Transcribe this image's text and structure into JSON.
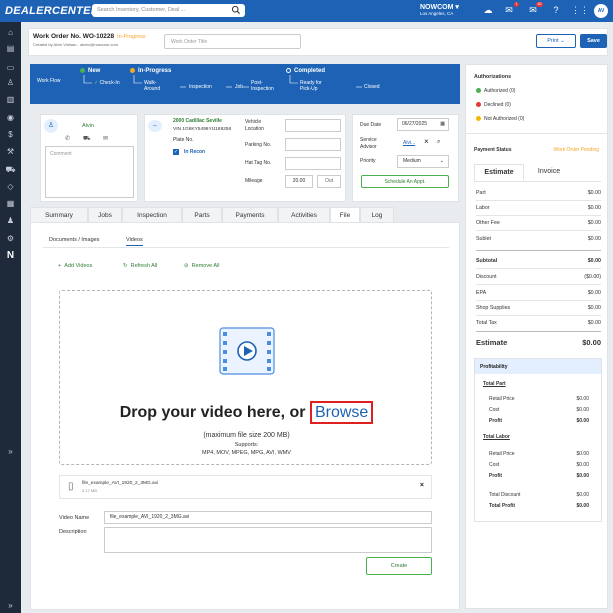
{
  "topbar": {
    "brand": "DEALERCENTER",
    "search_placeholder": "Search Inventory, Customer, Deal ...",
    "dealer_name": "NOWCOM",
    "dealer_location": "Los Angeles, CA",
    "notification_count_1": "1",
    "notification_count_2": "40",
    "avatar_initials": "AV"
  },
  "header": {
    "work_order_label": "Work Order No. WO-10228",
    "status": "In-Progress",
    "created_by": "Created by Alvin Vinluan - alvinv@nowcom.com",
    "title_placeholder": "Work Order Title",
    "print_label": "Print",
    "save_label": "Save"
  },
  "workflow": {
    "label": "Work Flow",
    "stages": {
      "new": "New",
      "in_progress": "In-Progress",
      "completed": "Completed"
    },
    "steps": {
      "check_in": "Check-In",
      "walk_around": "Walk-\nAround",
      "inspection": "Inspection",
      "job": "Job",
      "post_inspection": "Post-\nInspection",
      "ready_pickup": "Ready for\nPick-Up",
      "closed": "Closed"
    }
  },
  "customer": {
    "name": "Alvin",
    "comment_placeholder": "Comment"
  },
  "vehicle": {
    "model": "2000 Cadillac Seville",
    "vin": "VIN 1G6KY5496YU169258",
    "plate_label": "Plate No.",
    "in_recon": "In Recon",
    "location_label": "Vehicle\nLocation",
    "parking_label": "Parking No.",
    "hat_tag_label": "Hat Tag No.",
    "mileage_label": "Mileage",
    "mileage_value": "20.00",
    "mileage_out": "Out"
  },
  "service": {
    "due_date_label": "Due Date",
    "due_date": "06/27/2025",
    "advisor_label": "Service\nAdvisor",
    "advisor_value": "Alvi...",
    "priority_label": "Priority",
    "priority_value": "Medium",
    "schedule_label": "Schedule An Appt."
  },
  "tabs": [
    "Summary",
    "Jobs",
    "Inspection",
    "Parts",
    "Payments",
    "Activities",
    "File",
    "Log"
  ],
  "file_panel": {
    "subtabs": [
      "Documents / Images",
      "Videos"
    ],
    "add_videos": "Add Videos",
    "refresh_all": "Refresh All",
    "remove_all": "Remove All",
    "drop_text": "Drop your video here, or",
    "browse": "Browse",
    "max_size": "(maximum file size 200 MB)",
    "supports_label": "Supports:",
    "supports_formats": "MP4, MOV, MPEG, MPG, AVI, WMV",
    "file_name": "file_example_AVI_1920_2_3MG.avi",
    "file_size": "2.17 MB",
    "video_name_label": "Video Name",
    "video_name_value": "file_example_AVI_1920_2_3MG.avi",
    "description_label": "Description",
    "create_label": "Create"
  },
  "right_panel": {
    "authorizations_title": "Authorizations",
    "authorized": "Authorized (0)",
    "declined": "Declined (0)",
    "not_authorized": "Not Authorized (0)",
    "payment_status_label": "Payment Status",
    "payment_status_value": "Work Order Pending",
    "estimate_tab": "Estimate",
    "invoice_tab": "Invoice",
    "rows": [
      {
        "label": "Part",
        "value": "$0.00"
      },
      {
        "label": "Labor",
        "value": "$0.00"
      },
      {
        "label": "Other Fee",
        "value": "$0.00"
      },
      {
        "label": "Sublet",
        "value": "$0.00"
      }
    ],
    "rows2": [
      {
        "label": "Subtotal",
        "value": "$0.00"
      },
      {
        "label": "Discount",
        "value": "($0.00)"
      },
      {
        "label": "EPA",
        "value": "$0.00"
      },
      {
        "label": "Shop Supplies",
        "value": "$0.00"
      },
      {
        "label": "Total Tax",
        "value": "$0.00"
      }
    ],
    "estimate_total_label": "Estimate",
    "estimate_total_value": "$0.00",
    "profitability_title": "Profitability",
    "total_part": "Total Part",
    "part_rows": [
      {
        "label": "Retail Price",
        "value": "$0.00"
      },
      {
        "label": "Cost",
        "value": "$0.00"
      },
      {
        "label": "Profit",
        "value": "$0.00"
      }
    ],
    "total_labor": "Total Labor",
    "labor_rows": [
      {
        "label": "Retail Price",
        "value": "$0.00"
      },
      {
        "label": "Cost",
        "value": "$0.00"
      },
      {
        "label": "Profit",
        "value": "$0.00"
      }
    ],
    "total_discount_label": "Total Discount",
    "total_discount_value": "$0.00",
    "total_profit_label": "Total Profit",
    "total_profit_value": "$0.00"
  },
  "colors": {
    "brand_blue": "#1d62b5",
    "status_orange": "#f5a623",
    "authorized_green": "#4caf50",
    "declined_red": "#e53935",
    "not_authorized_yellow": "#f5b800",
    "browse_highlight": "#e02020"
  }
}
